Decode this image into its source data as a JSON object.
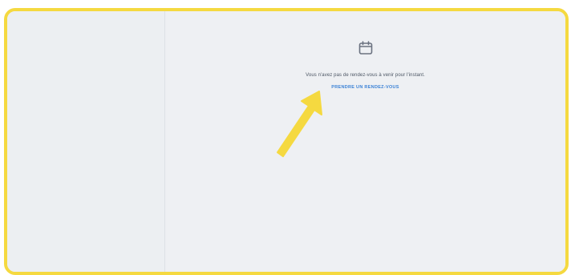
{
  "main": {
    "empty_state": {
      "icon": "calendar-icon",
      "message": "Vous n'avez pas de rendez-vous à venir pour l'instant.",
      "cta_label": "PRENDRE UN RENDEZ-VOUS"
    }
  },
  "annotation": {
    "icon": "arrow-icon",
    "color": "#f5d940"
  },
  "colors": {
    "frame_border": "#f5d940",
    "background": "#eef0f3",
    "link": "#3b82d6"
  }
}
